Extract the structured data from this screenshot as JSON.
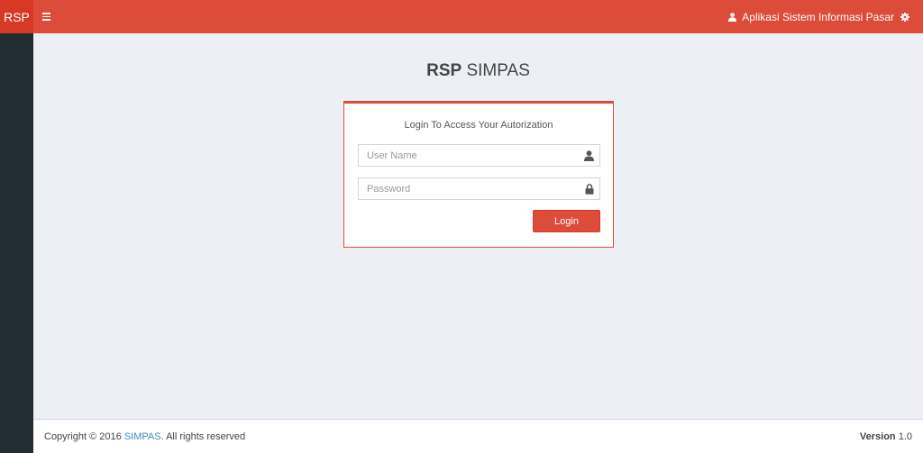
{
  "header": {
    "brand": "RSP",
    "app_title": "Aplikasi Sistem Informasi Pasar",
    "menu_icon": "bars-icon",
    "user_icon": "user-icon",
    "settings_icon": "gear-icon"
  },
  "logo": {
    "bold": "RSP",
    "light": "SIMPAS"
  },
  "login": {
    "message": "Login To Access Your Autorization",
    "username_placeholder": "User Name",
    "username_value": "",
    "password_placeholder": "Password",
    "password_value": "",
    "button_label": "Login"
  },
  "footer": {
    "copyright_prefix": "Copyright © 2016",
    "link_text": "SIMPAS",
    "copyright_suffix": ". All rights reserved",
    "version_label": "Version",
    "version_number": "1.0"
  },
  "colors": {
    "accent": "#dd4b39",
    "sidebar": "#222d32",
    "background": "#ecf0f5",
    "link": "#3c8dbc"
  }
}
